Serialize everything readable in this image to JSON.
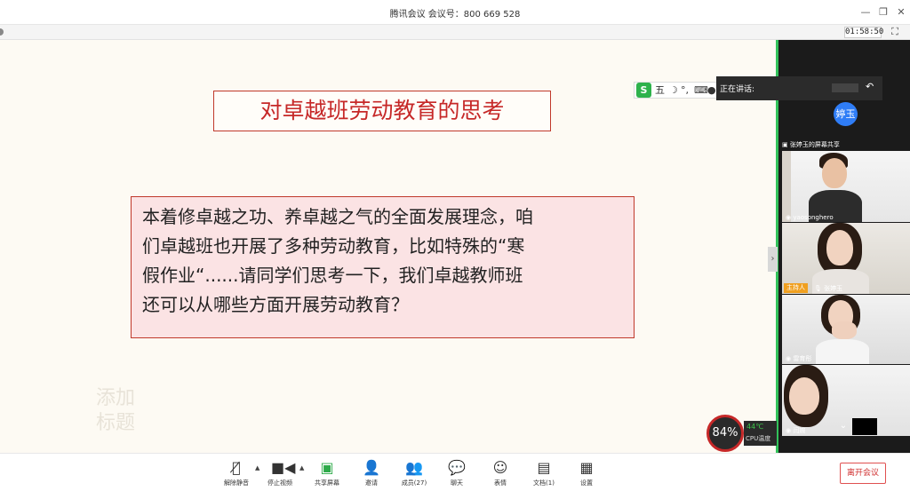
{
  "window": {
    "title": "腾讯会议 会议号：800 669 528",
    "timer": "01:58:50"
  },
  "slide": {
    "title": "对卓越班劳动教育的思考",
    "body_lines": [
      "本着修卓越之功、养卓越之气的全面发展理念，咱",
      "们卓越班也开展了多种劳动教育，比如特殊的“寒",
      "假作业“......请同学们思考一下，我们卓越教师班",
      "还可以从哪些方面开展劳动教育？"
    ],
    "watermark_lines": [
      "添加",
      "标题"
    ]
  },
  "ime": {
    "logo": "S",
    "mode": "五"
  },
  "speaking": {
    "label": "正在讲话:"
  },
  "sidebar": {
    "avatar_text": "婷玉",
    "share_label": "张婷玉的屏幕共享",
    "participants": [
      {
        "name": "yaosonghero"
      },
      {
        "name": "张婷玉",
        "badge": "主持人"
      },
      {
        "name": "雷育彤"
      },
      {
        "name": "闫婉"
      }
    ]
  },
  "cpu": {
    "usage": "84%",
    "temp": "44℃",
    "temp_label": "CPU温度"
  },
  "toolbar": {
    "items": [
      {
        "label": "解除静音",
        "icon": "mic-muted-icon"
      },
      {
        "label": "停止视频",
        "icon": "video-icon"
      },
      {
        "label": "共享屏幕",
        "icon": "share-screen-icon"
      },
      {
        "label": "邀请",
        "icon": "invite-icon"
      },
      {
        "label": "成员(27)",
        "icon": "members-icon"
      },
      {
        "label": "聊天",
        "icon": "chat-icon"
      },
      {
        "label": "表情",
        "icon": "emoji-icon"
      },
      {
        "label": "文档(1)",
        "icon": "document-icon"
      },
      {
        "label": "设置",
        "icon": "settings-icon"
      }
    ],
    "leave_label": "离开会议"
  },
  "colors": {
    "slide_title": "#c62828",
    "slide_box_bg": "#fbe3e4",
    "accent_green": "#32c25a",
    "avatar_blue": "#2f7df6",
    "host_badge": "#f0a020",
    "leave_red": "#d03030"
  }
}
